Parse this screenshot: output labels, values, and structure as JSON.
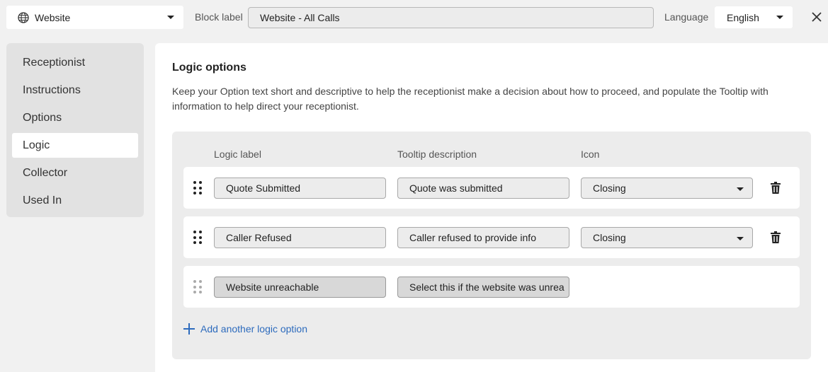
{
  "header": {
    "block_type": "Website",
    "block_label_caption": "Block label",
    "block_label_value": "Website - All Calls",
    "language_caption": "Language",
    "language_value": "English"
  },
  "sidebar": {
    "items": [
      {
        "label": "Receptionist",
        "active": false
      },
      {
        "label": "Instructions",
        "active": false
      },
      {
        "label": "Options",
        "active": false
      },
      {
        "label": "Logic",
        "active": true
      },
      {
        "label": "Collector",
        "active": false
      },
      {
        "label": "Used In",
        "active": false
      }
    ]
  },
  "main": {
    "title": "Logic options",
    "description": "Keep your Option text short and descriptive to help the receptionist make a decision about how to proceed, and populate the Tooltip with information to help direct your receptionist.",
    "columns": {
      "logic_label": "Logic label",
      "tooltip": "Tooltip description",
      "icon": "Icon"
    },
    "rows": [
      {
        "label": "Quote Submitted",
        "tooltip": "Quote was submitted",
        "icon": "Closing",
        "editable": true
      },
      {
        "label": "Caller Refused",
        "tooltip": "Caller refused to provide info",
        "icon": "Closing",
        "editable": true
      },
      {
        "label": "Website unreachable",
        "tooltip": "Select this if the website was unrea",
        "icon": "",
        "editable": false
      }
    ],
    "add_label": "Add another logic option"
  },
  "icons": {
    "block_type": "globe-icon",
    "close": "close-icon",
    "drag": "drag-handle-icon",
    "delete": "trash-icon",
    "add": "plus-icon"
  },
  "colors": {
    "accent": "#2d6bbd",
    "background": "#f1f1f1"
  }
}
